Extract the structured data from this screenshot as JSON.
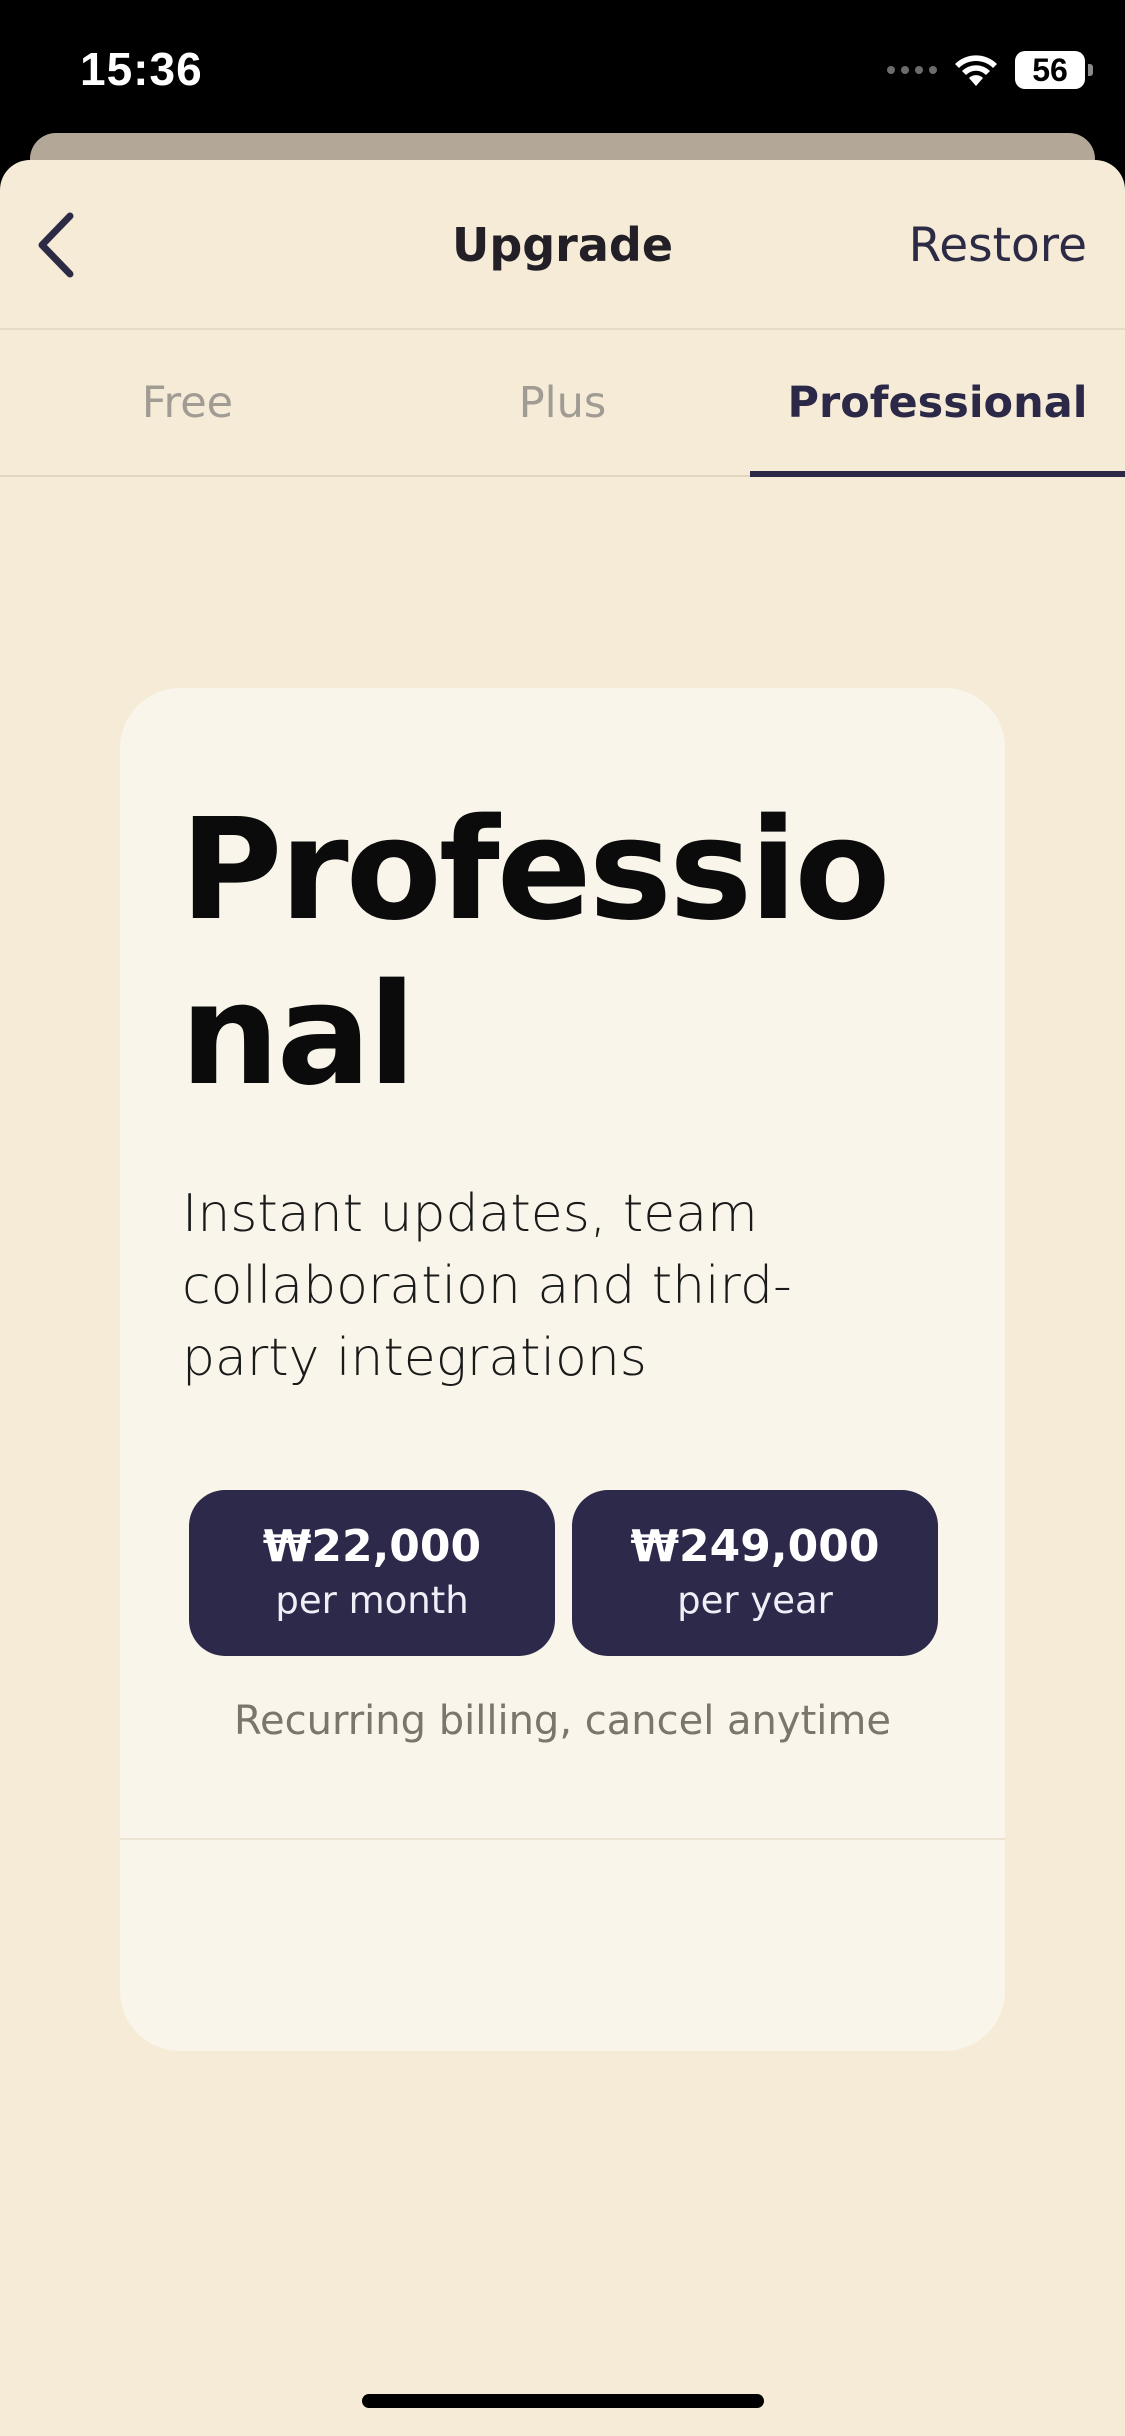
{
  "status_bar": {
    "time": "15:36",
    "battery": "56",
    "icons": [
      "signal-icon",
      "wifi-icon",
      "battery-icon"
    ]
  },
  "nav": {
    "title": "Upgrade",
    "restore_label": "Restore",
    "back_icon": "chevron-left-icon"
  },
  "tabs": [
    {
      "label": "Free",
      "active": false
    },
    {
      "label": "Plus",
      "active": false
    },
    {
      "label": "Professional",
      "active": true
    }
  ],
  "plan": {
    "title": "Professional",
    "description": "Instant updates, team collaboration and third-party integrations",
    "prices": [
      {
        "amount": "₩22,000",
        "period": "per month"
      },
      {
        "amount": "₩249,000",
        "period": "per year"
      }
    ],
    "billing_note": "Recurring billing, cancel anytime"
  },
  "colors": {
    "background": "#f5ebd6",
    "card": "#faf5ea",
    "accent": "#2c294a",
    "muted_text": "#a09c94"
  }
}
